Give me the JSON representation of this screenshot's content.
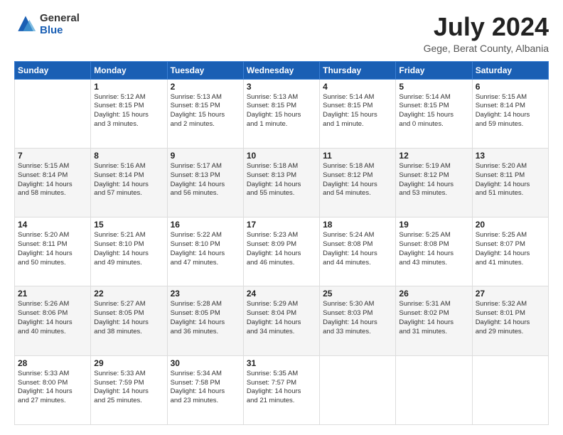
{
  "logo": {
    "general": "General",
    "blue": "Blue"
  },
  "header": {
    "month_year": "July 2024",
    "location": "Gege, Berat County, Albania"
  },
  "weekdays": [
    "Sunday",
    "Monday",
    "Tuesday",
    "Wednesday",
    "Thursday",
    "Friday",
    "Saturday"
  ],
  "weeks": [
    [
      {
        "day": "",
        "info": ""
      },
      {
        "day": "1",
        "info": "Sunrise: 5:12 AM\nSunset: 8:15 PM\nDaylight: 15 hours\nand 3 minutes."
      },
      {
        "day": "2",
        "info": "Sunrise: 5:13 AM\nSunset: 8:15 PM\nDaylight: 15 hours\nand 2 minutes."
      },
      {
        "day": "3",
        "info": "Sunrise: 5:13 AM\nSunset: 8:15 PM\nDaylight: 15 hours\nand 1 minute."
      },
      {
        "day": "4",
        "info": "Sunrise: 5:14 AM\nSunset: 8:15 PM\nDaylight: 15 hours\nand 1 minute."
      },
      {
        "day": "5",
        "info": "Sunrise: 5:14 AM\nSunset: 8:15 PM\nDaylight: 15 hours\nand 0 minutes."
      },
      {
        "day": "6",
        "info": "Sunrise: 5:15 AM\nSunset: 8:14 PM\nDaylight: 14 hours\nand 59 minutes."
      }
    ],
    [
      {
        "day": "7",
        "info": "Sunrise: 5:15 AM\nSunset: 8:14 PM\nDaylight: 14 hours\nand 58 minutes."
      },
      {
        "day": "8",
        "info": "Sunrise: 5:16 AM\nSunset: 8:14 PM\nDaylight: 14 hours\nand 57 minutes."
      },
      {
        "day": "9",
        "info": "Sunrise: 5:17 AM\nSunset: 8:13 PM\nDaylight: 14 hours\nand 56 minutes."
      },
      {
        "day": "10",
        "info": "Sunrise: 5:18 AM\nSunset: 8:13 PM\nDaylight: 14 hours\nand 55 minutes."
      },
      {
        "day": "11",
        "info": "Sunrise: 5:18 AM\nSunset: 8:12 PM\nDaylight: 14 hours\nand 54 minutes."
      },
      {
        "day": "12",
        "info": "Sunrise: 5:19 AM\nSunset: 8:12 PM\nDaylight: 14 hours\nand 53 minutes."
      },
      {
        "day": "13",
        "info": "Sunrise: 5:20 AM\nSunset: 8:11 PM\nDaylight: 14 hours\nand 51 minutes."
      }
    ],
    [
      {
        "day": "14",
        "info": "Sunrise: 5:20 AM\nSunset: 8:11 PM\nDaylight: 14 hours\nand 50 minutes."
      },
      {
        "day": "15",
        "info": "Sunrise: 5:21 AM\nSunset: 8:10 PM\nDaylight: 14 hours\nand 49 minutes."
      },
      {
        "day": "16",
        "info": "Sunrise: 5:22 AM\nSunset: 8:10 PM\nDaylight: 14 hours\nand 47 minutes."
      },
      {
        "day": "17",
        "info": "Sunrise: 5:23 AM\nSunset: 8:09 PM\nDaylight: 14 hours\nand 46 minutes."
      },
      {
        "day": "18",
        "info": "Sunrise: 5:24 AM\nSunset: 8:08 PM\nDaylight: 14 hours\nand 44 minutes."
      },
      {
        "day": "19",
        "info": "Sunrise: 5:25 AM\nSunset: 8:08 PM\nDaylight: 14 hours\nand 43 minutes."
      },
      {
        "day": "20",
        "info": "Sunrise: 5:25 AM\nSunset: 8:07 PM\nDaylight: 14 hours\nand 41 minutes."
      }
    ],
    [
      {
        "day": "21",
        "info": "Sunrise: 5:26 AM\nSunset: 8:06 PM\nDaylight: 14 hours\nand 40 minutes."
      },
      {
        "day": "22",
        "info": "Sunrise: 5:27 AM\nSunset: 8:05 PM\nDaylight: 14 hours\nand 38 minutes."
      },
      {
        "day": "23",
        "info": "Sunrise: 5:28 AM\nSunset: 8:05 PM\nDaylight: 14 hours\nand 36 minutes."
      },
      {
        "day": "24",
        "info": "Sunrise: 5:29 AM\nSunset: 8:04 PM\nDaylight: 14 hours\nand 34 minutes."
      },
      {
        "day": "25",
        "info": "Sunrise: 5:30 AM\nSunset: 8:03 PM\nDaylight: 14 hours\nand 33 minutes."
      },
      {
        "day": "26",
        "info": "Sunrise: 5:31 AM\nSunset: 8:02 PM\nDaylight: 14 hours\nand 31 minutes."
      },
      {
        "day": "27",
        "info": "Sunrise: 5:32 AM\nSunset: 8:01 PM\nDaylight: 14 hours\nand 29 minutes."
      }
    ],
    [
      {
        "day": "28",
        "info": "Sunrise: 5:33 AM\nSunset: 8:00 PM\nDaylight: 14 hours\nand 27 minutes."
      },
      {
        "day": "29",
        "info": "Sunrise: 5:33 AM\nSunset: 7:59 PM\nDaylight: 14 hours\nand 25 minutes."
      },
      {
        "day": "30",
        "info": "Sunrise: 5:34 AM\nSunset: 7:58 PM\nDaylight: 14 hours\nand 23 minutes."
      },
      {
        "day": "31",
        "info": "Sunrise: 5:35 AM\nSunset: 7:57 PM\nDaylight: 14 hours\nand 21 minutes."
      },
      {
        "day": "",
        "info": ""
      },
      {
        "day": "",
        "info": ""
      },
      {
        "day": "",
        "info": ""
      }
    ]
  ]
}
